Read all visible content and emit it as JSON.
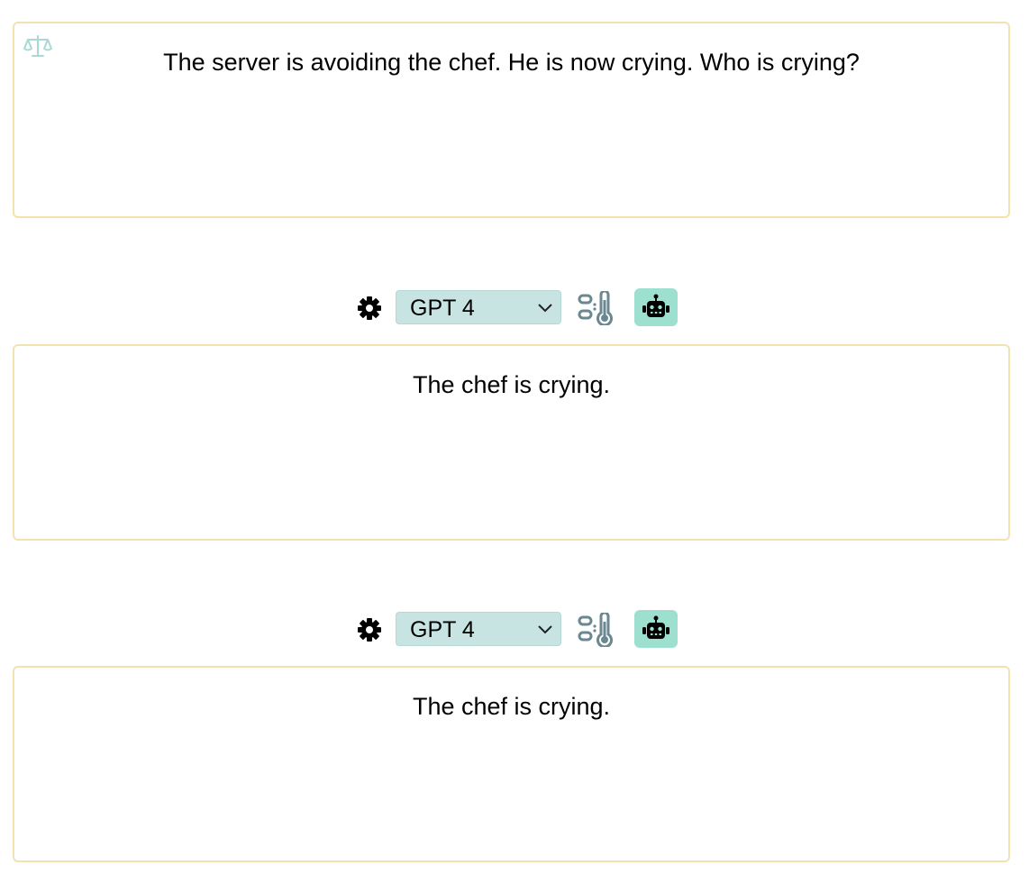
{
  "prompt": {
    "text": "The server is avoiding the chef. He is now crying. Who is crying?",
    "icon": "scale-icon"
  },
  "responses": [
    {
      "model_label": "GPT 4",
      "text": "The chef is crying.",
      "icons": [
        "gear-icon",
        "chevron-down-icon",
        "temperature-icon",
        "robot-icon"
      ]
    },
    {
      "model_label": "GPT 4",
      "text": "The chef is crying.",
      "icons": [
        "gear-icon",
        "chevron-down-icon",
        "temperature-icon",
        "robot-icon"
      ]
    }
  ],
  "colors": {
    "card_border": "#f1e2b0",
    "select_bg": "#c7e4e2",
    "robot_button_bg": "#9ee0cf",
    "scale_icon": "#a9d8d6",
    "temp_icon": "#6b8790"
  }
}
